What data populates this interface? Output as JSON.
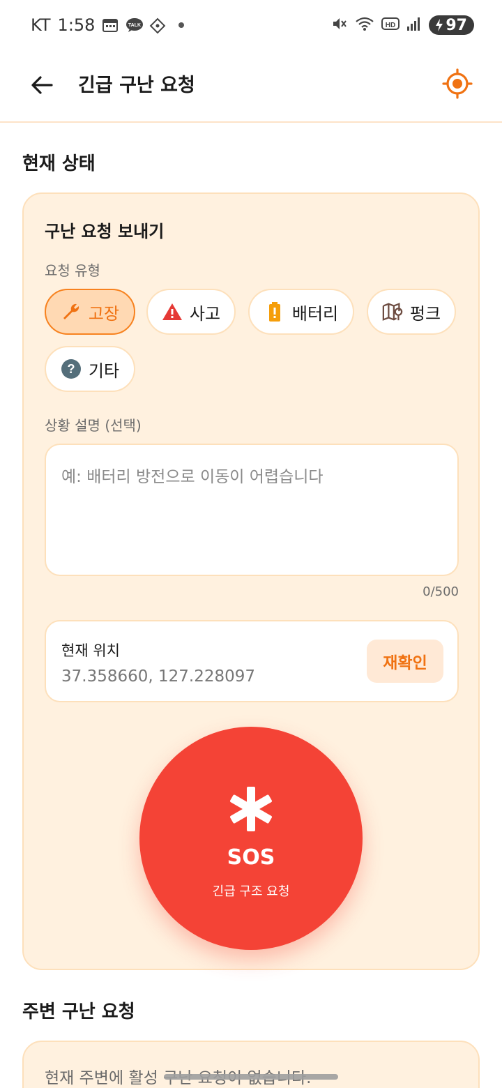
{
  "status_bar": {
    "carrier": "KT",
    "time": "1:58",
    "battery": "97"
  },
  "app_bar": {
    "title": "긴급 구난 요청"
  },
  "current_status": {
    "section_title": "현재 상태"
  },
  "request_card": {
    "title": "구난 요청 보내기",
    "type_label": "요청 유형",
    "types": [
      {
        "label": "고장",
        "icon": "wrench-icon",
        "selected": true
      },
      {
        "label": "사고",
        "icon": "warning-icon",
        "selected": false
      },
      {
        "label": "배터리",
        "icon": "battery-icon",
        "selected": false
      },
      {
        "label": "펑크",
        "icon": "tire-location-icon",
        "selected": false
      },
      {
        "label": "기타",
        "icon": "help-icon",
        "selected": false
      }
    ],
    "description_label": "상황 설명 (선택)",
    "description_placeholder": "예: 배터리 방전으로 이동이 어렵습니다",
    "char_counter": "0/500",
    "location": {
      "label": "현재 위치",
      "value": "37.358660, 127.228097",
      "recheck_label": "재확인"
    },
    "sos": {
      "label": "SOS",
      "sub_label": "긴급 구조 요청"
    }
  },
  "nearby": {
    "section_title": "주변 구난 요청",
    "empty_text": "현재 주변에 활성 구난 요청이 없습니다."
  },
  "colors": {
    "accent": "#f07212",
    "sos_red": "#f44336",
    "card_bg": "#fff1df",
    "card_border": "#fde0bb"
  }
}
